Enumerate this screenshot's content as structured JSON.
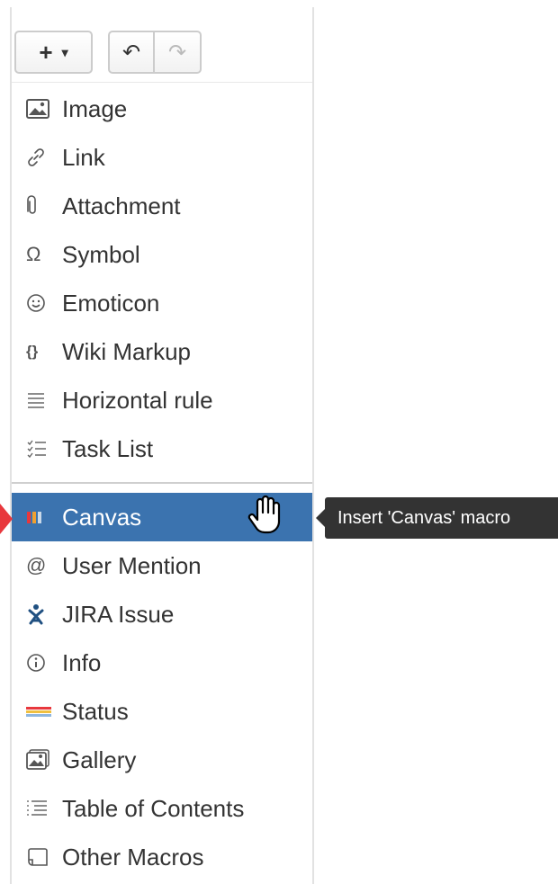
{
  "toolbar": {
    "insert_label": "+",
    "insert_caret": "▾",
    "undo_glyph": "↶",
    "redo_glyph": "↷"
  },
  "menu": {
    "group1": [
      {
        "label": "Image",
        "icon": "image-icon"
      },
      {
        "label": "Link",
        "icon": "link-icon"
      },
      {
        "label": "Attachment",
        "icon": "paperclip-icon"
      },
      {
        "label": "Symbol",
        "icon": "omega-icon"
      },
      {
        "label": "Emoticon",
        "icon": "smiley-icon"
      },
      {
        "label": "Wiki Markup",
        "icon": "braces-icon"
      },
      {
        "label": "Horizontal rule",
        "icon": "horizontal-rule-icon"
      },
      {
        "label": "Task List",
        "icon": "task-list-icon"
      }
    ],
    "group2": [
      {
        "label": "Canvas",
        "icon": "canvas-icon",
        "active": true
      },
      {
        "label": "User Mention",
        "icon": "at-icon"
      },
      {
        "label": "JIRA Issue",
        "icon": "jira-icon"
      },
      {
        "label": "Info",
        "icon": "info-icon"
      },
      {
        "label": "Status",
        "icon": "status-icon"
      },
      {
        "label": "Gallery",
        "icon": "gallery-icon"
      },
      {
        "label": "Table of Contents",
        "icon": "toc-icon"
      },
      {
        "label": "Other Macros",
        "icon": "other-macros-icon"
      }
    ]
  },
  "tooltip": "Insert 'Canvas' macro",
  "colors": {
    "active_bg": "#3b73af",
    "tooltip_bg": "#333333",
    "arrow": "#e8383d"
  }
}
